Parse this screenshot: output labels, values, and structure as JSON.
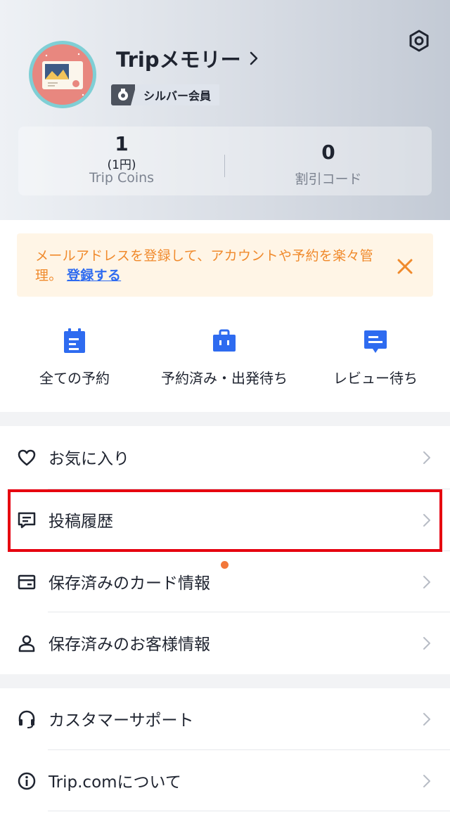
{
  "profile": {
    "name": "Tripメモリー",
    "tier_label": "シルバー会員"
  },
  "stats": {
    "coins_value": "1",
    "coins_sub": "(1円)",
    "coins_label": "Trip Coins",
    "discount_value": "0",
    "discount_label": "割引コード"
  },
  "notice": {
    "text": "メールアドレスを登録して、アカウントや予約を楽々管理。",
    "link_label": "登録する",
    "color": "#f08a2c"
  },
  "quick_actions": [
    {
      "label": "全ての予約",
      "icon": "calendar-icon"
    },
    {
      "label": "予約済み・出発待ち",
      "icon": "suitcase-icon"
    },
    {
      "label": "レビュー待ち",
      "icon": "review-icon"
    }
  ],
  "menu": {
    "group1": [
      {
        "label": "お気に入り",
        "icon": "heart-icon"
      },
      {
        "label": "投稿履歴",
        "icon": "comment-icon",
        "highlighted": true
      },
      {
        "label": "保存済みのカード情報",
        "icon": "card-icon",
        "has_dot": true
      },
      {
        "label": "保存済みのお客様情報",
        "icon": "person-icon"
      }
    ],
    "group2": [
      {
        "label": "カスタマーサポート",
        "icon": "headset-icon"
      },
      {
        "label": "Trip.comについて",
        "icon": "info-icon"
      }
    ]
  },
  "colors": {
    "accent_blue": "#2e6bf0",
    "notice_orange": "#f08a2c",
    "highlight_red": "#e6000f"
  }
}
